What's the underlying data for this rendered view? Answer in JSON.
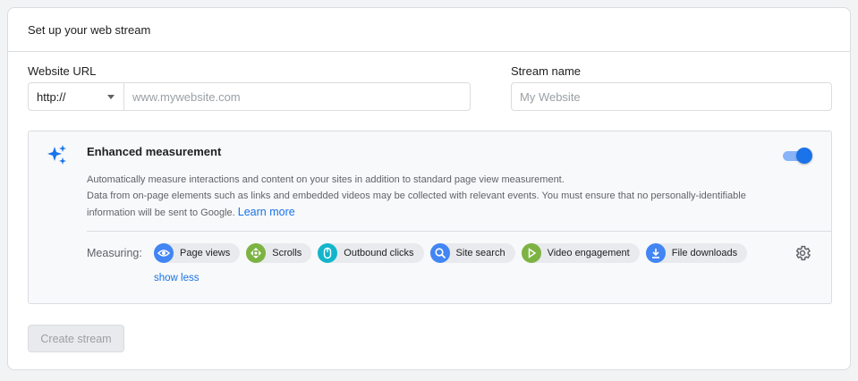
{
  "header": {
    "title": "Set up your web stream"
  },
  "form": {
    "url_label": "Website URL",
    "protocol_value": "http://",
    "url_placeholder": "www.mywebsite.com",
    "url_value": "",
    "stream_label": "Stream name",
    "stream_placeholder": "My Website",
    "stream_value": ""
  },
  "enhanced": {
    "title": "Enhanced measurement",
    "desc_line1": "Automatically measure interactions and content on your sites in addition to standard page view measurement.",
    "desc_line2": "Data from on-page elements such as links and embedded videos may be collected with relevant events. You must ensure that no personally-identifiable information will be sent to Google.",
    "learn_more": "Learn more",
    "enabled": true,
    "measuring_label": "Measuring:",
    "chips": [
      {
        "label": "Page views",
        "icon": "eye-icon",
        "color": "#4285f4"
      },
      {
        "label": "Scrolls",
        "icon": "scroll-arrows-icon",
        "color": "#7cb342"
      },
      {
        "label": "Outbound clicks",
        "icon": "mouse-icon",
        "color": "#12b5cb"
      },
      {
        "label": "Site search",
        "icon": "search-icon",
        "color": "#4285f4"
      },
      {
        "label": "Video engagement",
        "icon": "play-icon",
        "color": "#7cb342"
      },
      {
        "label": "File downloads",
        "icon": "download-icon",
        "color": "#4285f4"
      }
    ],
    "show_less": "show less"
  },
  "actions": {
    "create_label": "Create stream"
  },
  "colors": {
    "accent": "#1a73e8",
    "sparkle": "#1a73e8"
  }
}
